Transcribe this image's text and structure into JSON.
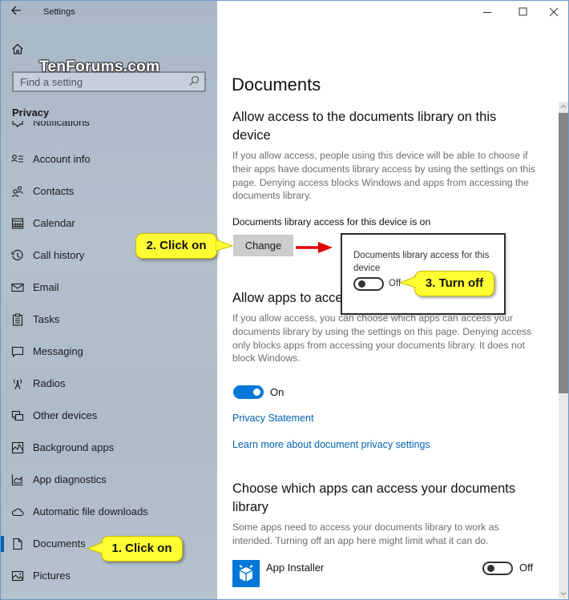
{
  "window": {
    "app_title": "Settings",
    "controls": {
      "minimize": "minimize-icon",
      "maximize": "maximize-icon",
      "close": "close-icon"
    }
  },
  "watermark": "TenForums.com",
  "sidebar": {
    "search_placeholder": "Find a setting",
    "section_label": "Privacy",
    "items": [
      {
        "label": "Notifications",
        "icon": "notifications-icon",
        "partial": true
      },
      {
        "label": "Account info",
        "icon": "account-info-icon"
      },
      {
        "label": "Contacts",
        "icon": "contacts-icon"
      },
      {
        "label": "Calendar",
        "icon": "calendar-icon"
      },
      {
        "label": "Call history",
        "icon": "call-history-icon"
      },
      {
        "label": "Email",
        "icon": "email-icon"
      },
      {
        "label": "Tasks",
        "icon": "tasks-icon"
      },
      {
        "label": "Messaging",
        "icon": "messaging-icon"
      },
      {
        "label": "Radios",
        "icon": "radios-icon"
      },
      {
        "label": "Other devices",
        "icon": "other-devices-icon"
      },
      {
        "label": "Background apps",
        "icon": "background-apps-icon"
      },
      {
        "label": "App diagnostics",
        "icon": "app-diagnostics-icon"
      },
      {
        "label": "Automatic file downloads",
        "icon": "cloud-icon"
      },
      {
        "label": "Documents",
        "icon": "document-icon",
        "selected": true
      },
      {
        "label": "Pictures",
        "icon": "pictures-icon"
      }
    ]
  },
  "main": {
    "page_title": "Documents",
    "device_section": {
      "heading": "Allow access to the documents library on this device",
      "description": " If you allow access, people using this device will be able to choose if their apps have documents library access by using the settings on this page. Denying access blocks Windows and apps from accessing the documents library.",
      "status": "Documents library access for this device is on",
      "change_button": "Change"
    },
    "popup": {
      "title": "Documents library access for this device",
      "toggle_state": "Off"
    },
    "apps_section": {
      "heading": "Allow apps to access your documents library",
      "heading_visible": "Allow apps to acce",
      "description": " If you allow access, you can choose which apps can access your documents library by using the settings on this page. Denying access only blocks apps from accessing your documents library. It does not block Windows.",
      "toggle_state": "On"
    },
    "links": {
      "privacy_statement": "Privacy Statement",
      "learn_more": "Learn more about document privacy settings"
    },
    "choose_section": {
      "heading": "Choose which apps can access your documents library",
      "description": "Some apps need to access your documents library to work as intended. Turning off an app here might limit what it can do.",
      "apps": [
        {
          "name": "App Installer",
          "toggle_state": "Off"
        }
      ]
    }
  },
  "callouts": {
    "step1": "1. Click on",
    "step2": "2. Click on",
    "step3": "3. Turn off"
  },
  "colors": {
    "accent": "#0078d7",
    "link": "#0063b1",
    "callout": "#ffff33",
    "arrow": "#e00000"
  }
}
